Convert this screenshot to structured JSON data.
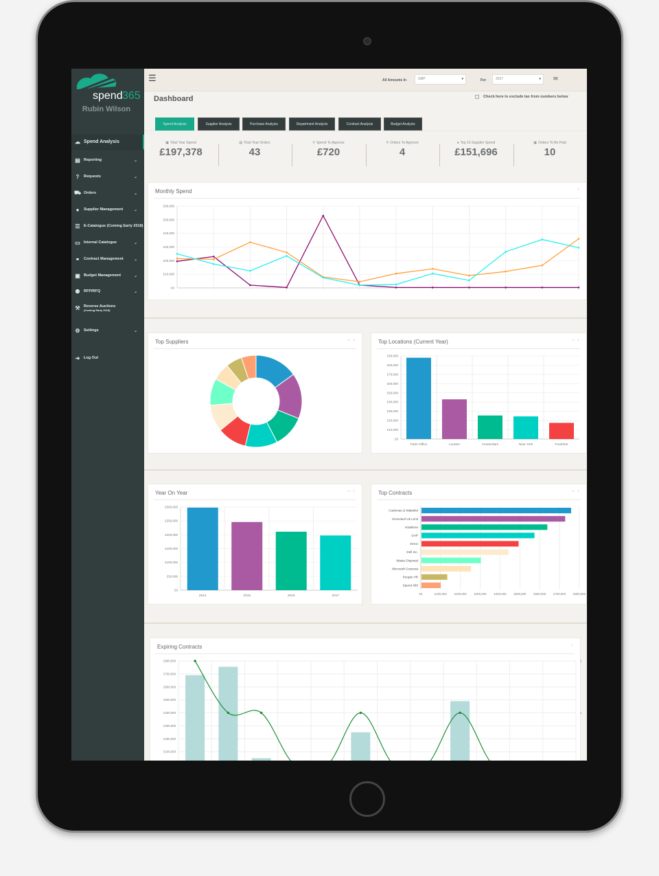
{
  "brand": {
    "name": "spend",
    "name_suffix": "365",
    "user": "Rubin Wilson",
    "accent": "#1aab8a",
    "sidebar_bg": "#323e3e"
  },
  "sidebar": {
    "items": [
      {
        "label": "Spend Analysis",
        "icon": "cloud-chart-icon",
        "active": true
      },
      {
        "label": "Reporting",
        "icon": "document-icon",
        "chevron": true
      },
      {
        "label": "Requests",
        "icon": "question-icon",
        "chevron": true
      },
      {
        "label": "Orders",
        "icon": "cart-icon",
        "chevron": true
      },
      {
        "label": "Supplier Management",
        "icon": "user-icon",
        "chevron": true
      },
      {
        "label": "E-Catalogue (Coming Early 2018)",
        "icon": "list-icon"
      },
      {
        "label": "Internal Catalogue",
        "icon": "basket-icon",
        "chevron": true
      },
      {
        "label": "Contract Management",
        "icon": "handshake-icon",
        "chevron": true
      },
      {
        "label": "Budget Management",
        "icon": "money-icon",
        "chevron": true
      },
      {
        "label": "RFP/RFQ",
        "icon": "users-icon",
        "chevron": true
      },
      {
        "label": "Reverse Auctions",
        "sublabel": "(Coming Early 2018)",
        "icon": "gavel-icon"
      },
      {
        "label": "Settings",
        "icon": "gears-icon",
        "chevron": true
      },
      {
        "label": "Log Out",
        "icon": "sign-out-icon"
      }
    ]
  },
  "header": {
    "amounts_label": "All Amounts In",
    "currency": "GBP",
    "for_label": "For",
    "year": "2017",
    "menu_icon": "hamburger-icon",
    "mail_icon": "envelope-icon"
  },
  "page": {
    "title": "Dashboard",
    "tax_checkbox_label": "Check here to exclude tax from numbers below",
    "tax_checked": false
  },
  "tabs": [
    {
      "label": "Spend Analysis",
      "active": true
    },
    {
      "label": "Supplier Analysis"
    },
    {
      "label": "Purchase Analysis"
    },
    {
      "label": "Department Analysis"
    },
    {
      "label": "Contract Analysis"
    },
    {
      "label": "Budget Analysis"
    }
  ],
  "stats": [
    {
      "label": "Total Year Spend",
      "icon": "money-icon",
      "glyph": "▣",
      "value": "£197,378"
    },
    {
      "label": "Total Year Orders",
      "icon": "list-icon",
      "glyph": "▤",
      "value": "43"
    },
    {
      "label": "Spend To Approve",
      "icon": "search-icon",
      "glyph": "⚲",
      "value": "£720"
    },
    {
      "label": "Orders To Approve",
      "icon": "search-icon",
      "glyph": "⚲",
      "value": "4"
    },
    {
      "label": "Top 10 Supplier Spend",
      "icon": "user-icon",
      "glyph": "●",
      "value": "£151,696"
    },
    {
      "label": "Orders To Be Paid",
      "icon": "money-icon",
      "glyph": "▣",
      "value": "10"
    }
  ],
  "panels": {
    "monthly": "Monthly Spend",
    "suppliers": "Top Suppliers",
    "locations": "Top Locations (Current Year)",
    "yoy": "Year On Year",
    "contracts": "Top Contracts",
    "expiring": "Expiring Contracts",
    "tools": "↔ ↓",
    "download": "↓"
  },
  "chart_data": [
    {
      "id": "monthly",
      "type": "line",
      "title": "Monthly Spend",
      "ylim": [
        0,
        60000
      ],
      "yticks": [
        "£0",
        "£10,000",
        "£20,000",
        "£30,000",
        "£40,000",
        "£50,000",
        "£60,000"
      ],
      "grid": true,
      "series": [
        {
          "color": "#8b0a72",
          "values": [
            19500,
            23000,
            2000,
            300,
            53000,
            2000,
            300,
            300,
            300,
            300,
            300,
            300
          ]
        },
        {
          "color": "#ff9f3a",
          "values": [
            21500,
            21000,
            33500,
            26000,
            8000,
            4500,
            10500,
            14000,
            9000,
            12000,
            16500,
            36000
          ]
        },
        {
          "color": "#26f0f0",
          "values": [
            25000,
            17500,
            12500,
            23500,
            7500,
            2000,
            2500,
            10500,
            5500,
            26500,
            35500,
            29500
          ]
        }
      ]
    },
    {
      "id": "suppliers",
      "type": "pie",
      "title": "Top Suppliers",
      "donut": true,
      "values": [
        16,
        17,
        12,
        12,
        11,
        10,
        10,
        6.5,
        6,
        5.5
      ],
      "colors": [
        "#2199cc",
        "#aa5aa3",
        "#00bb8f",
        "#00cfc4",
        "#f44242",
        "#fdebd0",
        "#6fffc8",
        "#fde3b8",
        "#c8b865",
        "#ffa070"
      ]
    },
    {
      "id": "locations",
      "type": "bar",
      "title": "Top Locations (Current Year)",
      "categories": [
        "Paris Office",
        "London",
        "Amsterdam",
        "New York",
        "Frankfurt"
      ],
      "values": [
        88000,
        43000,
        25500,
        24500,
        17500
      ],
      "colors": [
        "#2199cc",
        "#aa5aa3",
        "#00bb8f",
        "#00cfc4",
        "#f44242"
      ],
      "ylim": [
        0,
        90000
      ],
      "yticks": [
        "£0",
        "£10,000",
        "£20,000",
        "£30,000",
        "£40,000",
        "£50,000",
        "£60,000",
        "£70,000",
        "£80,000",
        "£90,000"
      ]
    },
    {
      "id": "yoy",
      "type": "bar",
      "title": "Year On Year",
      "categories": [
        "2014",
        "2015",
        "2016",
        "2017"
      ],
      "values": [
        298000,
        246000,
        211000,
        197378
      ],
      "colors": [
        "#2199cc",
        "#aa5aa3",
        "#00bb8f",
        "#00cfc4"
      ],
      "ylim": [
        0,
        300000
      ],
      "yticks": [
        "£0",
        "£50,000",
        "£100,000",
        "£150,000",
        "£200,000",
        "£250,000",
        "£300,000"
      ]
    },
    {
      "id": "contracts",
      "type": "bar",
      "orientation": "horizontal",
      "title": "Top Contracts",
      "categories": [
        "Cushman & Wakefiel",
        "Groonloof Uk Limit",
        "Vodafone",
        "OAP",
        "Xerox",
        "Dell Inc.",
        "Waste Disposal",
        "Microsoft Corporat",
        "People HR",
        "Spend-365"
      ],
      "values": [
        755000,
        725000,
        635000,
        570000,
        490000,
        440000,
        300000,
        250000,
        130000,
        97000
      ],
      "colors": [
        "#2199cc",
        "#aa5aa3",
        "#00bb8f",
        "#00cfc4",
        "#f44242",
        "#fdebd0",
        "#6fffc8",
        "#fde3b8",
        "#c8b865",
        "#ffa070"
      ],
      "xlim": [
        0,
        800000
      ],
      "xticks": [
        "£0",
        "£100,000",
        "£200,000",
        "£300,000",
        "£400,000",
        "£500,000",
        "£600,000",
        "£700,000",
        "£800,000"
      ]
    },
    {
      "id": "expiring",
      "type": "bar+line",
      "title": "Expiring Contracts",
      "bar_color": "#b4dada",
      "line_color": "#1e8f3a",
      "ylim": [
        0,
        800000
      ],
      "yticks": [
        "£100,000",
        "£200,000",
        "£300,000",
        "£400,000",
        "£500,000",
        "£600,000",
        "£700,000",
        "£800,000"
      ],
      "y2lim": [
        0,
        2
      ],
      "y2ticks": [
        "1",
        "2"
      ],
      "bars": [
        690000,
        755000,
        50000,
        0,
        0,
        250000,
        0,
        0,
        490000,
        0,
        0,
        0
      ],
      "line": [
        2,
        1,
        1,
        0,
        0,
        1,
        0,
        0,
        1,
        0,
        0,
        0
      ]
    }
  ]
}
